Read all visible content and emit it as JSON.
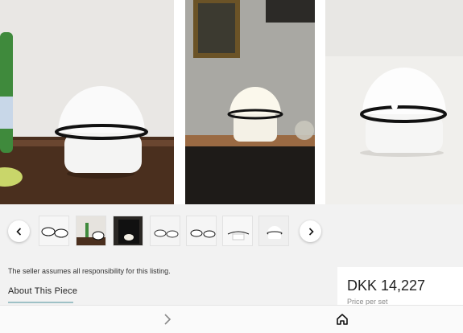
{
  "gallery": {
    "thumbnail_count": 7
  },
  "listing": {
    "seller_note": "The seller assumes all responsibility for this listing.",
    "about_title": "About This Piece",
    "accent_color": "#9ec1c6"
  },
  "price_card": {
    "price": "DKK 14,227",
    "subtitle": "Price per set"
  },
  "icons": {
    "prev": "chevron-left-icon",
    "next": "chevron-right-icon",
    "forward": "chevron-right-icon",
    "home": "home-icon"
  }
}
